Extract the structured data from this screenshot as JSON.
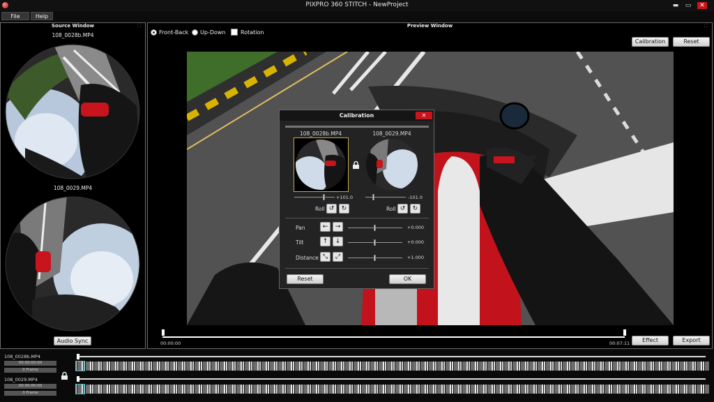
{
  "window": {
    "title": "PIXPRO 360 STITCH - NewProject",
    "minimize": "▬",
    "maximize": "▭",
    "close": "✕"
  },
  "menu": {
    "file": "File",
    "help": "Help"
  },
  "source_window": {
    "title": "Source Window",
    "expand_glyph": "⛶",
    "file_a": "108_0028b.MP4",
    "file_b": "108_0029.MP4",
    "audio_sync": "Audio Sync"
  },
  "preview_window": {
    "title": "Preview Window",
    "expand_glyph": "⛶",
    "options": {
      "front_back": "Front-Back",
      "up_down": "Up-Down",
      "rotation": "Rotation",
      "selected": "front_back"
    },
    "calibration_button": "Calibration",
    "reset_button": "Reset",
    "time_start": "00:00:00",
    "time_end": "00:07:11",
    "effect_button": "Effect",
    "export_button": "Export"
  },
  "calibration_dialog": {
    "title": "Calibration",
    "close": "✕",
    "left": {
      "file": "108_0028b.MP4",
      "value": "+101.0",
      "roll_label": "Roll"
    },
    "right": {
      "file": "108_0029.MP4",
      "value": "-101.0",
      "roll_label": "Roll"
    },
    "lock_icon": "lock-icon",
    "rows": [
      {
        "label": "Pan",
        "value": "+0.000",
        "btn_a": "←",
        "btn_b": "→"
      },
      {
        "label": "Tilt",
        "value": "+0.000",
        "btn_a": "↑",
        "btn_b": "↓"
      },
      {
        "label": "Distance",
        "value": "+1.000",
        "btn_a": "⤡",
        "btn_b": "⤢"
      }
    ],
    "reset_button": "Reset",
    "ok_button": "OK",
    "rotate_ccw": "↺",
    "rotate_cw": "↻"
  },
  "timeline": {
    "track_a": {
      "name": "108_0028b.MP4",
      "timecode": "00:00:00:00",
      "frame": "0 Frame"
    },
    "track_b": {
      "name": "108_0029.MP4",
      "timecode": "00:00:00:00",
      "frame": "0 Frame"
    }
  },
  "colors": {
    "close_red": "#c8141c",
    "motorcycle_red": "#d2141e",
    "road_gray": "#525252"
  }
}
